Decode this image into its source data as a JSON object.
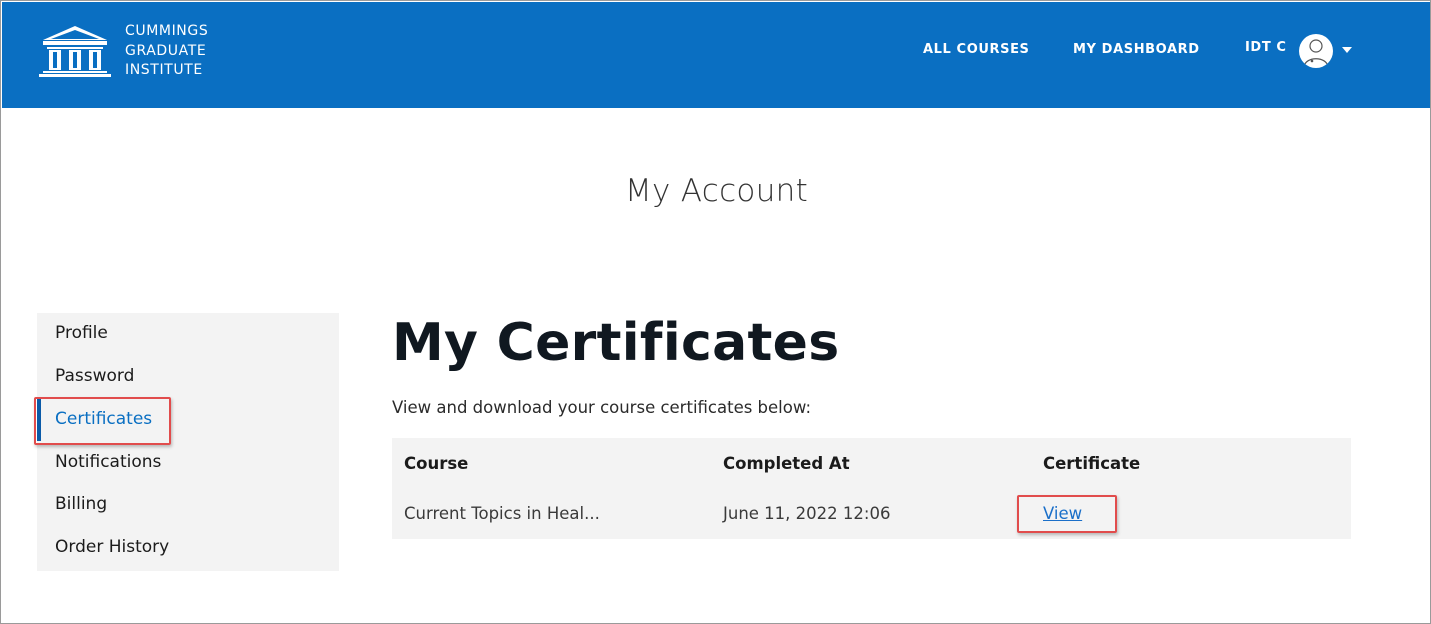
{
  "header": {
    "logo_lines": [
      "CUMMINGS",
      "GRADUATE",
      "INSTITUTE"
    ],
    "nav": {
      "all_courses": "ALL COURSES",
      "my_dashboard": "MY DASHBOARD",
      "user_name": "IDT C"
    },
    "brand_color": "#0a6fc2",
    "logo_icon": "columns-building-icon",
    "avatar_icon": "user-avatar-icon",
    "menu_icon": "caret-down-icon"
  },
  "page": {
    "title": "My Account"
  },
  "sidebar": {
    "items": [
      {
        "label": "Profile"
      },
      {
        "label": "Password"
      },
      {
        "label": "Certificates",
        "active": true
      },
      {
        "label": "Notifications"
      },
      {
        "label": "Billing"
      },
      {
        "label": "Order History"
      }
    ]
  },
  "main": {
    "heading": "My Certificates",
    "subtitle": "View and download your course certificates below:",
    "table": {
      "columns": [
        "Course",
        "Completed At",
        "Certificate"
      ],
      "rows": [
        {
          "course": "Current Topics in Heal...",
          "completed_at": "June 11, 2022 12:06",
          "certificate_link": "View"
        }
      ]
    }
  },
  "annotation_color": "#e14c4c"
}
